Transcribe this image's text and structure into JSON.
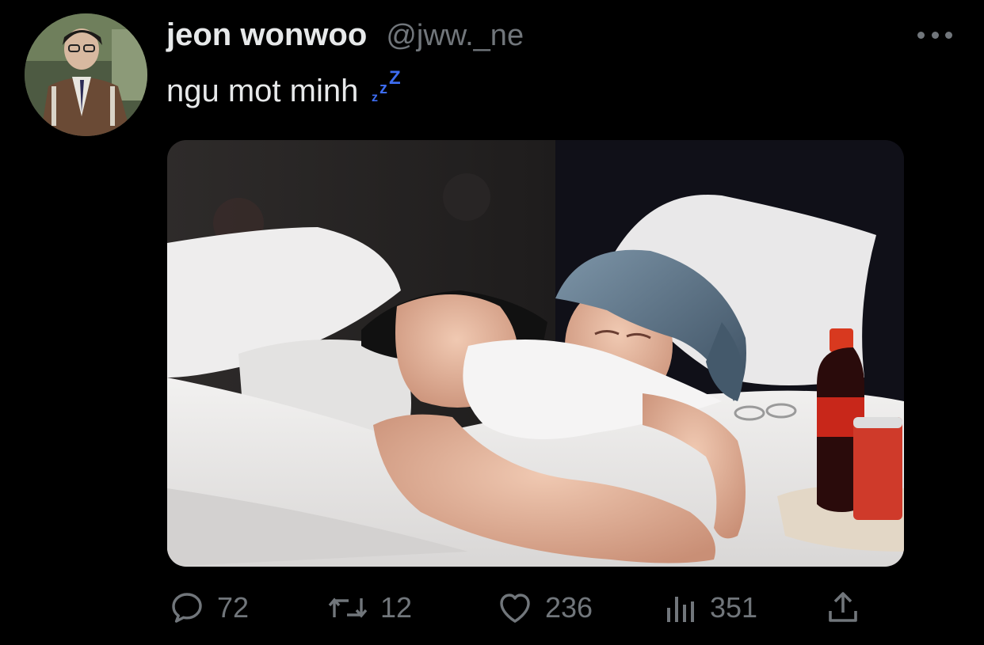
{
  "author": {
    "display_name": "jeon wonwoo",
    "handle": "@jww._ne",
    "avatar_icon": "profile-photo"
  },
  "tweet": {
    "text": "ngu mot minh",
    "emoji": "zzz-sleeping-emoji",
    "media_alt": "photo of a person lying in bed with white sheets next to a cola bottle and can"
  },
  "actions": {
    "replies": "72",
    "retweets": "12",
    "likes": "236",
    "views": "351"
  },
  "colors": {
    "background": "#000000",
    "text_primary": "#e7e9ea",
    "text_secondary": "#71767b",
    "emoji_blue": "#3d6cf0"
  }
}
